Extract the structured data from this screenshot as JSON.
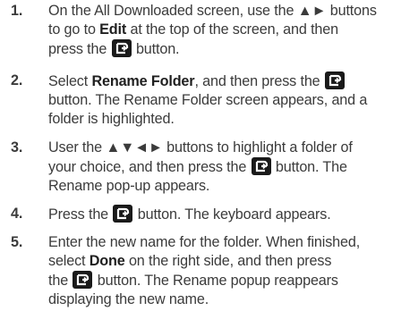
{
  "steps": [
    {
      "number": "1.",
      "l1": "On the All Downloaded screen, use the ▲► buttons",
      "l2a": "to go to ",
      "l2b": "Edit",
      "l2c": " at the top of the screen, and then",
      "l3a": "press the ",
      "l3b": " button."
    },
    {
      "number": "2.",
      "l1a": "Select ",
      "l1b": "Rename Folder",
      "l1c": ", and then press the ",
      "l2": "button. The Rename Folder screen appears, and a",
      "l3": "folder is highlighted."
    },
    {
      "number": "3.",
      "l1": "User the ▲▼◄► buttons to highlight a folder of",
      "l2a": "your choice, and then press the ",
      "l2b": " button. The",
      "l3": "Rename pop-up appears."
    },
    {
      "number": "4.",
      "l1a": "Press the ",
      "l1b": " button. The keyboard appears."
    },
    {
      "number": "5.",
      "l1": "Enter the new name for the folder. When finished,",
      "l2a": "select ",
      "l2b": "Done",
      "l2c": " on the right side, and then press",
      "l3a": "the ",
      "l3b": " button. The Rename popup reappears",
      "l4": "displaying the new name."
    }
  ],
  "icon": "enter-button-icon"
}
